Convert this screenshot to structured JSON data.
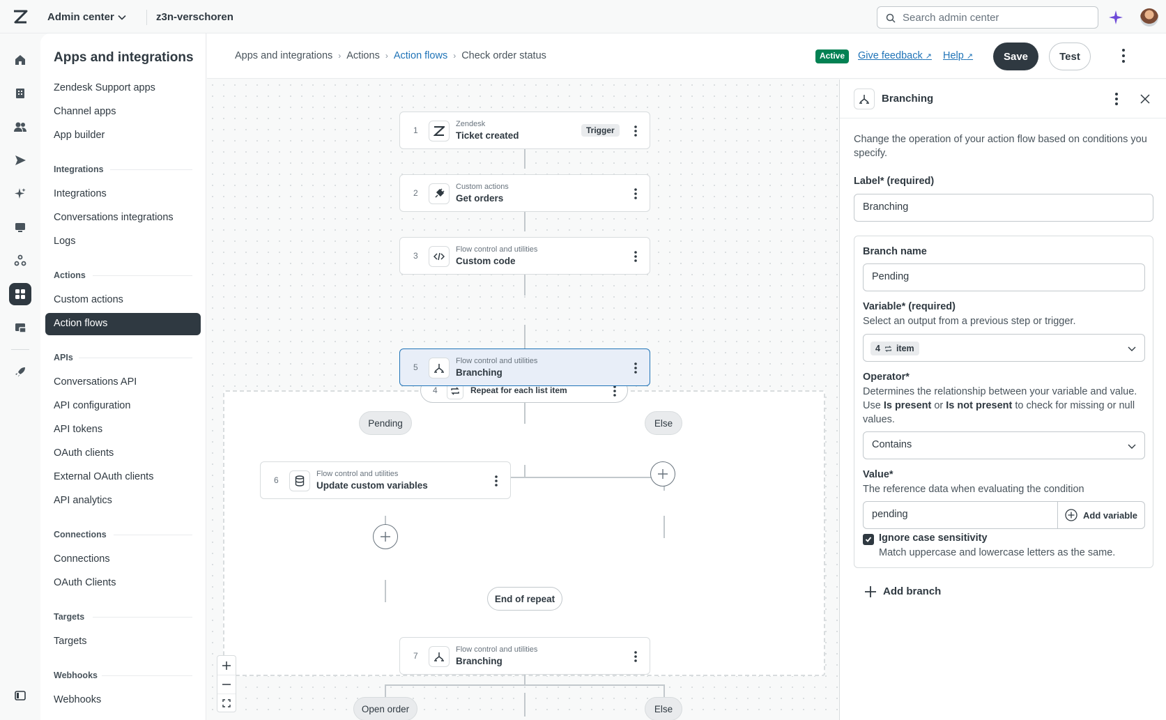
{
  "topbar": {
    "product": "Admin center",
    "account": "z3n-verschoren",
    "search_placeholder": "Search admin center"
  },
  "nav": {
    "title": "Apps and integrations",
    "groups": [
      {
        "heading": "",
        "items": [
          "Zendesk Support apps",
          "Channel apps",
          "App builder"
        ]
      },
      {
        "heading": "Integrations",
        "items": [
          "Integrations",
          "Conversations integrations",
          "Logs"
        ]
      },
      {
        "heading": "Actions",
        "items": [
          "Custom actions",
          "Action flows"
        ]
      },
      {
        "heading": "APIs",
        "items": [
          "Conversations API",
          "API configuration",
          "API tokens",
          "OAuth clients",
          "External OAuth clients",
          "API analytics"
        ]
      },
      {
        "heading": "Connections",
        "items": [
          "Connections",
          "OAuth Clients"
        ]
      },
      {
        "heading": "Targets",
        "items": [
          "Targets"
        ]
      },
      {
        "heading": "Webhooks",
        "items": [
          "Webhooks"
        ]
      }
    ],
    "active_item": "Action flows"
  },
  "header": {
    "breadcrumbs": [
      "Apps and integrations",
      "Actions",
      "Action flows",
      "Check order status"
    ],
    "status_badge": "Active",
    "feedback_link": "Give feedback",
    "help_link": "Help",
    "save_label": "Save",
    "test_label": "Test"
  },
  "flow": {
    "steps": [
      {
        "num": "1",
        "category": "Zendesk",
        "title": "Ticket created",
        "tag": "Trigger",
        "icon": "zendesk-icon"
      },
      {
        "num": "2",
        "category": "Custom actions",
        "title": "Get orders",
        "icon": "plug-icon"
      },
      {
        "num": "3",
        "category": "Flow control and utilities",
        "title": "Custom code",
        "icon": "code-icon"
      },
      {
        "num": "4",
        "category": "",
        "title": "Repeat for each list item",
        "icon": "repeat-icon"
      },
      {
        "num": "5",
        "category": "Flow control and utilities",
        "title": "Branching",
        "icon": "branch-icon",
        "selected": true
      },
      {
        "num": "6",
        "category": "Flow control and utilities",
        "title": "Update custom variables",
        "icon": "database-icon"
      },
      {
        "num": "7",
        "category": "Flow control and utilities",
        "title": "Branching",
        "icon": "branch-icon"
      }
    ],
    "branch_labels": [
      "Pending",
      "Else"
    ],
    "end_of_repeat": "End of repeat",
    "branch2_labels": [
      "Open order",
      "Else"
    ]
  },
  "panel": {
    "title": "Branching",
    "description": "Change the operation of your action flow based on conditions you specify.",
    "label_field_label": "Label* (required)",
    "label_field_value": "Branching",
    "branch_name_label": "Branch name",
    "branch_name_value": "Pending",
    "variable_label": "Variable* (required)",
    "variable_hint": "Select an output from a previous step or trigger.",
    "variable_step": "4",
    "variable_value": "item",
    "operator_label": "Operator*",
    "operator_hint_1": "Determines the relationship between your variable and value. Use ",
    "operator_hint_bold_1": "Is present",
    "operator_hint_2": " or ",
    "operator_hint_bold_2": "Is not present",
    "operator_hint_3": " to check for missing or null values.",
    "operator_value": "Contains",
    "value_label": "Value*",
    "value_hint": "The reference data when evaluating the condition",
    "value_value": "pending",
    "add_variable_label": "Add variable",
    "ignore_case_label": "Ignore case sensitivity",
    "ignore_case_checked": true,
    "ignore_case_hint": "Match uppercase and lowercase letters as the same.",
    "add_branch_label": "Add branch"
  },
  "colors": {
    "accent": "#1f73b7",
    "dark": "#2f3941",
    "active_badge": "#038153",
    "sparkle": "#6e4ad8"
  }
}
